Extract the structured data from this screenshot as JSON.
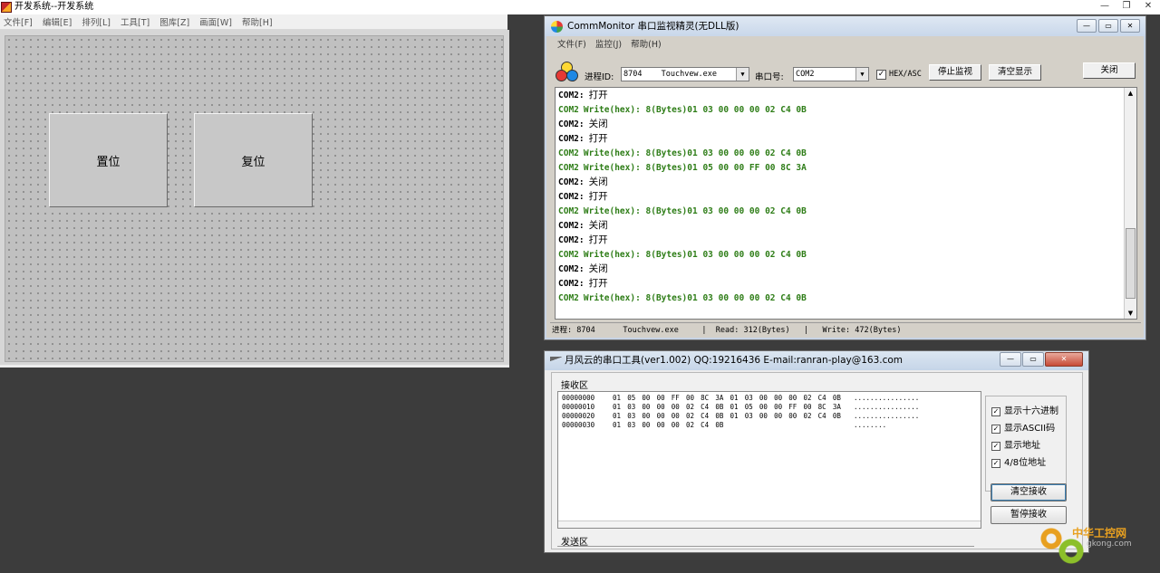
{
  "main_window": {
    "title": "开发系统--开发系统",
    "win_buttons": [
      "—",
      "❐",
      "✕"
    ],
    "menu": [
      "文件[F]",
      "编辑[E]",
      "排列[L]",
      "工具[T]",
      "图库[Z]",
      "画面[W]",
      "帮助[H]"
    ],
    "canvas": {
      "buttons": [
        "置位",
        "复位"
      ]
    }
  },
  "comm_monitor": {
    "title": "CommMonitor 串口监视精灵(无DLL版)",
    "win_buttons": [
      "—",
      "▭",
      "✕"
    ],
    "menu": [
      "文件(F)",
      "监控(J)",
      "帮助(H)"
    ],
    "toolbar": {
      "process_label": "进程ID:",
      "process_pid": "8704",
      "process_name": "Touchvew.exe",
      "port_label": "串口号:",
      "port_value": "COM2",
      "hex_checked": true,
      "hex_label": "HEX/ASC",
      "stop_label": "停止监视",
      "clear_label": "清空显示",
      "close_label": "关闭"
    },
    "log": [
      {
        "type": "status",
        "port": "COM2:",
        "text": "打开"
      },
      {
        "type": "write",
        "port": "COM2",
        "text": "Write(hex): 8(Bytes)01 03 00 00 00 02 C4 0B"
      },
      {
        "type": "status",
        "port": "COM2:",
        "text": "关闭"
      },
      {
        "type": "status",
        "port": "COM2:",
        "text": "打开"
      },
      {
        "type": "write",
        "port": "COM2",
        "text": "Write(hex): 8(Bytes)01 03 00 00 00 02 C4 0B"
      },
      {
        "type": "write",
        "port": "COM2",
        "text": "Write(hex): 8(Bytes)01 05 00 00 FF 00 8C 3A"
      },
      {
        "type": "status",
        "port": "COM2:",
        "text": "关闭"
      },
      {
        "type": "status",
        "port": "COM2:",
        "text": "打开"
      },
      {
        "type": "write",
        "port": "COM2",
        "text": "Write(hex): 8(Bytes)01 03 00 00 00 02 C4 0B"
      },
      {
        "type": "status",
        "port": "COM2:",
        "text": "关闭"
      },
      {
        "type": "status",
        "port": "COM2:",
        "text": "打开"
      },
      {
        "type": "write",
        "port": "COM2",
        "text": "Write(hex): 8(Bytes)01 03 00 00 00 02 C4 0B"
      },
      {
        "type": "status",
        "port": "COM2:",
        "text": "关闭"
      },
      {
        "type": "status",
        "port": "COM2:",
        "text": "打开"
      },
      {
        "type": "write",
        "port": "COM2",
        "text": "Write(hex): 8(Bytes)01 03 00 00 00 02 C4 0B"
      }
    ],
    "status_bar": "进程: 8704      Touchvew.exe     |  Read: 312(Bytes)   |   Write: 472(Bytes)"
  },
  "serial_tool": {
    "title": "月风云的串口工具(ver1.002)   QQ:19216436   E-mail:ranran-play@163.com",
    "win_buttons": [
      "—",
      "▭",
      "✕"
    ],
    "receive_label": "接收区",
    "send_label": "发送区",
    "hex_rows": [
      {
        "addr": "00000000",
        "bytes": [
          "01",
          "05",
          "00",
          "00",
          "FF",
          "00",
          "8C",
          "3A",
          "01",
          "03",
          "00",
          "00",
          "00",
          "02",
          "C4",
          "0B"
        ],
        "ascii": "................"
      },
      {
        "addr": "00000010",
        "bytes": [
          "01",
          "03",
          "00",
          "00",
          "00",
          "02",
          "C4",
          "0B",
          "01",
          "05",
          "00",
          "00",
          "FF",
          "00",
          "8C",
          "3A"
        ],
        "ascii": "................"
      },
      {
        "addr": "00000020",
        "bytes": [
          "01",
          "03",
          "00",
          "00",
          "00",
          "02",
          "C4",
          "0B",
          "01",
          "03",
          "00",
          "00",
          "00",
          "02",
          "C4",
          "0B"
        ],
        "ascii": "................"
      },
      {
        "addr": "00000030",
        "bytes": [
          "01",
          "03",
          "00",
          "00",
          "00",
          "02",
          "C4",
          "0B"
        ],
        "ascii": "........"
      }
    ],
    "options": [
      {
        "label": "显示十六进制",
        "checked": true
      },
      {
        "label": "显示ASCII码",
        "checked": true
      },
      {
        "label": "显示地址",
        "checked": true
      },
      {
        "label": "4/8位地址",
        "checked": true
      }
    ],
    "clear_button": "清空接收",
    "pause_button": "暂停接收"
  },
  "watermark": {
    "cn": "中华工控网",
    "en": "gkong.com"
  }
}
